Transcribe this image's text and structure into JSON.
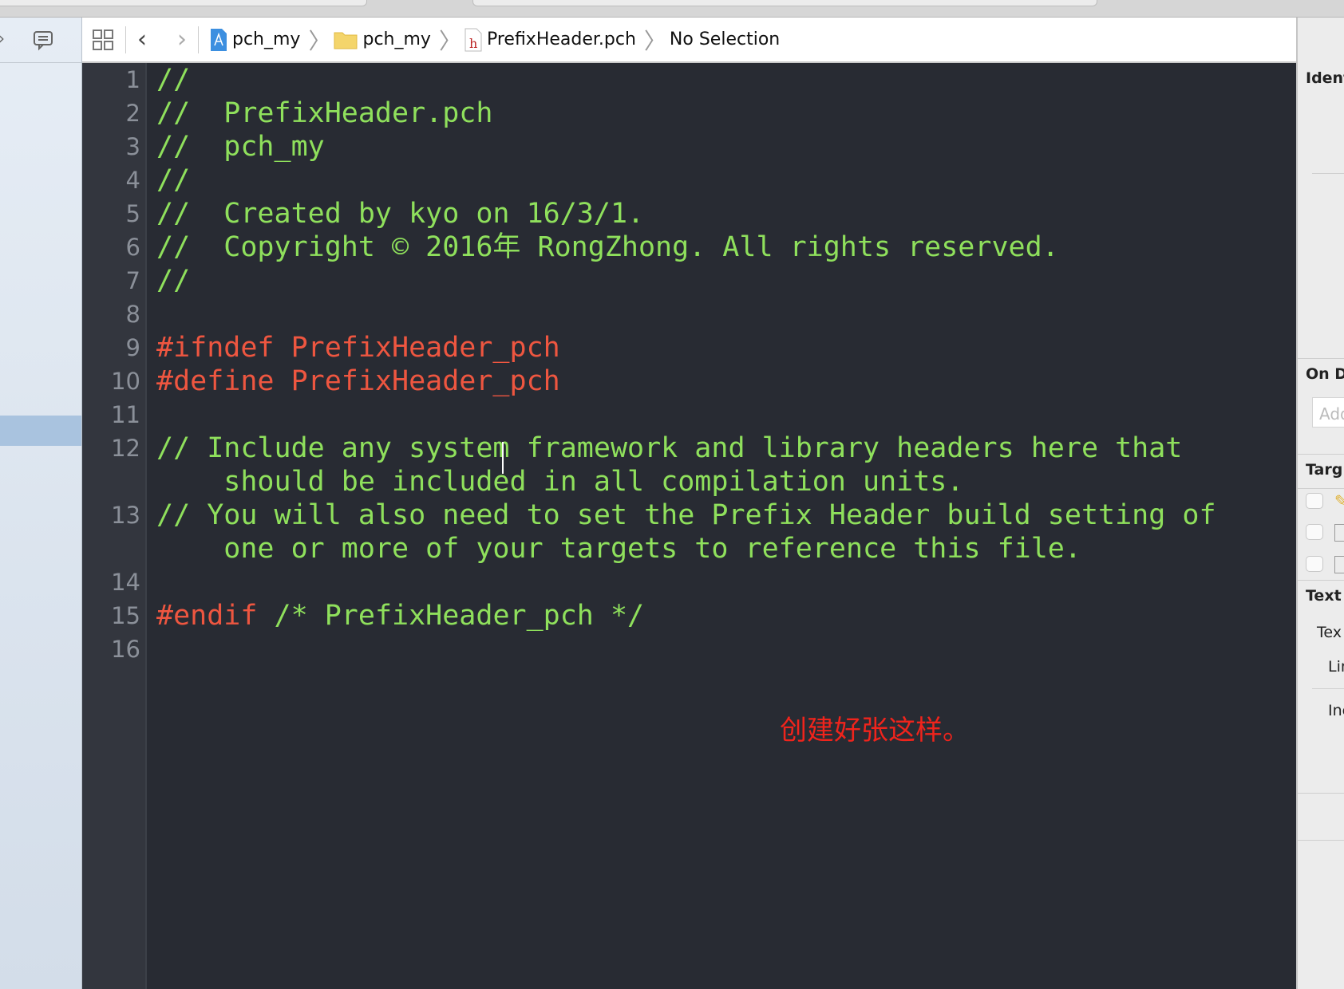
{
  "toolbar": {
    "breadcrumbs": [
      {
        "label": "pch_my",
        "icon": "xcode-project-icon"
      },
      {
        "label": "pch_my",
        "icon": "folder-icon"
      },
      {
        "label": "PrefixHeader.pch",
        "icon": "header-file-icon"
      },
      {
        "label": "No Selection"
      }
    ]
  },
  "editor": {
    "line_numbers": [
      "1",
      "2",
      "3",
      "4",
      "5",
      "6",
      "7",
      "8",
      "9",
      "10",
      "11",
      "12",
      "13",
      "14",
      "15",
      "16"
    ],
    "lines": [
      {
        "text": "//",
        "color": "green"
      },
      {
        "text": "//  PrefixHeader.pch",
        "color": "green"
      },
      {
        "text": "//  pch_my",
        "color": "green"
      },
      {
        "text": "//",
        "color": "green"
      },
      {
        "text": "//  Created by kyo on 16/3/1.",
        "color": "green"
      },
      {
        "text": "//  Copyright © 2016年 RongZhong. All rights reserved.",
        "color": "green"
      },
      {
        "text": "//",
        "color": "green"
      },
      {
        "text": "",
        "color": "green"
      },
      {
        "text": "#ifndef PrefixHeader_pch",
        "color": "red"
      },
      {
        "text": "#define PrefixHeader_pch",
        "color": "red"
      },
      {
        "text": "",
        "color": "green"
      },
      {
        "text": "// Include any system framework and library headers here that",
        "color": "green"
      },
      {
        "text": "    should be included in all compilation units.",
        "color": "green"
      },
      {
        "text": "// You will also need to set the Prefix Header build setting of",
        "color": "green"
      },
      {
        "text": "    one or more of your targets to reference this file.",
        "color": "green"
      },
      {
        "text": "",
        "color": "green"
      },
      {
        "text_red": "#endif",
        "text_green": " /* PrefixHeader_pch */"
      },
      {
        "text": "",
        "color": "green"
      }
    ],
    "annotation": "创建好张这样。"
  },
  "inspector": {
    "identity": "Ident",
    "on_demand": "On D",
    "add_placeholder": "Add",
    "target": "Targ",
    "text_settings": "Text",
    "text_encoding": "Tex",
    "line_endings": "Lin",
    "indent": "Ine"
  },
  "colors": {
    "comment": "#8fe05c",
    "preprocessor": "#ee5640",
    "background": "#282b33",
    "annotation": "#f0241c"
  }
}
